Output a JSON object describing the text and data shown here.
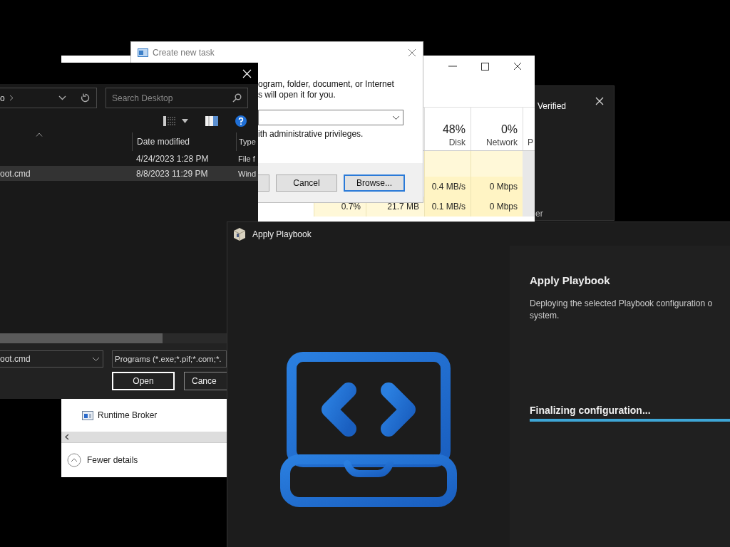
{
  "task_manager": {
    "columns": [
      {
        "value": "48%",
        "label": "Disk"
      },
      {
        "value": "0%",
        "label": "Network"
      },
      {
        "label": "P"
      }
    ],
    "rows": [
      {
        "disk": "0.4 MB/s",
        "network": "0 Mbps"
      },
      {
        "cpu": "0.7%",
        "memory": "21.7 MB",
        "disk": "0.1 MB/s",
        "network": "0 Mbps"
      }
    ],
    "process": "Runtime Broker",
    "fewer_details": "Fewer details"
  },
  "side_window": {
    "title": "Verified",
    "text": "er"
  },
  "create_task": {
    "title": "Create new task",
    "description_lines": [
      "ogram, folder, document, or Internet",
      "s will open it for you."
    ],
    "admin_text": "ith administrative privileges.",
    "buttons": [
      {
        "label": "Cancel",
        "focused": false
      },
      {
        "label": "Browse...",
        "focused": true
      }
    ]
  },
  "file_dialog": {
    "address": "o",
    "search_placeholder": "Search Desktop",
    "columns": [
      "Date modified",
      "Type"
    ],
    "rows": [
      {
        "date": "4/24/2023 1:28 PM",
        "type": "File f",
        "selected": false
      },
      {
        "name": "oot.cmd",
        "date": "8/8/2023 11:29 PM",
        "type": "Wind",
        "selected": true
      }
    ],
    "file_name": "oot.cmd",
    "file_type": "Programs (*.exe;*.pif;*.com;*.",
    "buttons": [
      {
        "label": "Open",
        "focused": true
      },
      {
        "label": "Cance",
        "focused": false
      }
    ]
  },
  "apply_playbook": {
    "title": "Apply Playbook",
    "heading": "Apply Playbook",
    "description_lines": [
      "Deploying the selected Playbook configuration o",
      "system."
    ],
    "status": "Finalizing configuration...",
    "progress": {
      "level": 1
    }
  }
}
